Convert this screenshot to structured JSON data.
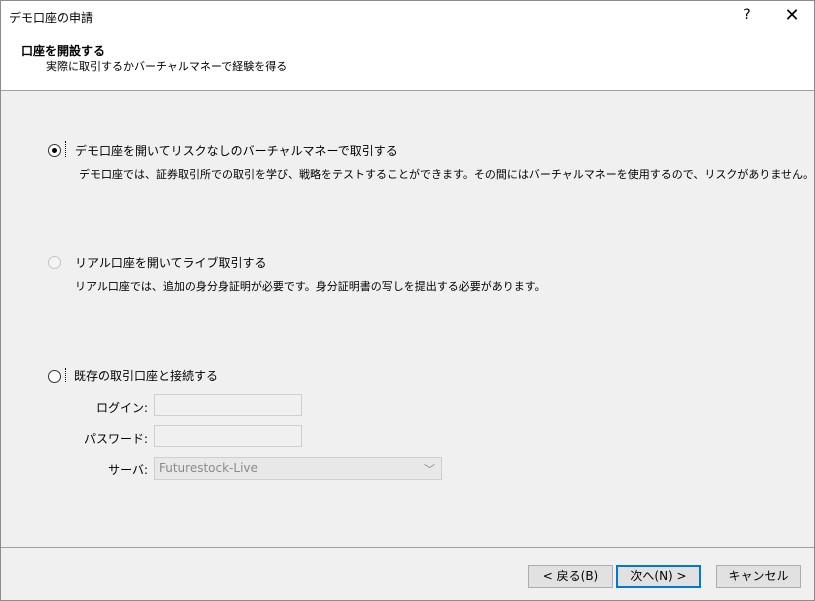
{
  "window": {
    "title": "デモ口座の申請",
    "help_glyph": "?",
    "close_glyph": "✕"
  },
  "header": {
    "title": "口座を開設する",
    "subtitle": "実際に取引するかバーチャルマネーで経験を得る"
  },
  "options": [
    {
      "label": "デモ口座を開いてリスクなしのバーチャルマネーで取引する",
      "description": "デモ口座では、証券取引所での取引を学び、戦略をテストすることができます。その間にはバーチャルマネーを使用するので、リスクがありません。",
      "selected": true,
      "enabled": true
    },
    {
      "label": "リアル口座を開いてライブ取引する",
      "description": "リアル口座では、追加の身分身証明が必要です。身分証明書の写しを提出する必要があります。",
      "selected": false,
      "enabled": false
    },
    {
      "label": "既存の取引口座と接続する",
      "selected": false,
      "enabled": true
    }
  ],
  "connect_form": {
    "login_label": "ログイン:",
    "login_value": "",
    "password_label": "パスワード:",
    "password_value": "",
    "server_label": "サーバ:",
    "server_value": "Futurestock-Live"
  },
  "buttons": {
    "back": "< 戻る(B)",
    "next": "次へ(N) >",
    "cancel": "キャンセル"
  }
}
